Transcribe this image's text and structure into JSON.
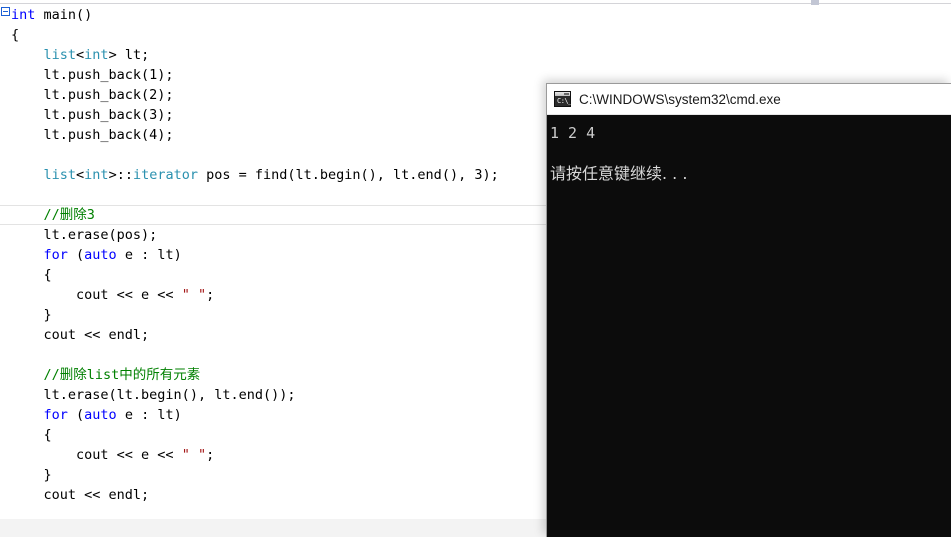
{
  "editor": {
    "name": "code-editor",
    "language": "cpp",
    "fold_marker": "collapse-minus",
    "lines": [
      {
        "indent": 0,
        "current": false,
        "tokens": [
          {
            "t": "kw",
            "v": "int"
          },
          {
            "t": "pln",
            "v": " main()"
          }
        ]
      },
      {
        "indent": 0,
        "current": false,
        "tokens": [
          {
            "t": "pln",
            "v": "{"
          }
        ]
      },
      {
        "indent": 1,
        "current": false,
        "tokens": [
          {
            "t": "type",
            "v": "list"
          },
          {
            "t": "pln",
            "v": "<"
          },
          {
            "t": "type",
            "v": "int"
          },
          {
            "t": "pln",
            "v": "> lt;"
          }
        ]
      },
      {
        "indent": 1,
        "current": false,
        "tokens": [
          {
            "t": "pln",
            "v": "lt.push_back(1);"
          }
        ]
      },
      {
        "indent": 1,
        "current": false,
        "tokens": [
          {
            "t": "pln",
            "v": "lt.push_back(2);"
          }
        ]
      },
      {
        "indent": 1,
        "current": false,
        "tokens": [
          {
            "t": "pln",
            "v": "lt.push_back(3);"
          }
        ]
      },
      {
        "indent": 1,
        "current": false,
        "tokens": [
          {
            "t": "pln",
            "v": "lt.push_back(4);"
          }
        ]
      },
      {
        "indent": 0,
        "current": false,
        "tokens": []
      },
      {
        "indent": 1,
        "current": false,
        "tokens": [
          {
            "t": "type",
            "v": "list"
          },
          {
            "t": "pln",
            "v": "<"
          },
          {
            "t": "type",
            "v": "int"
          },
          {
            "t": "pln",
            "v": ">::"
          },
          {
            "t": "type",
            "v": "iterator"
          },
          {
            "t": "pln",
            "v": " pos = find(lt.begin(), lt.end(), 3);"
          }
        ]
      },
      {
        "indent": 0,
        "current": false,
        "tokens": []
      },
      {
        "indent": 1,
        "current": true,
        "tokens": [
          {
            "t": "com",
            "v": "//删除3"
          }
        ]
      },
      {
        "indent": 1,
        "current": false,
        "tokens": [
          {
            "t": "pln",
            "v": "lt.erase(pos);"
          }
        ]
      },
      {
        "indent": 1,
        "current": false,
        "tokens": [
          {
            "t": "kw",
            "v": "for"
          },
          {
            "t": "pln",
            "v": " ("
          },
          {
            "t": "kw",
            "v": "auto"
          },
          {
            "t": "pln",
            "v": " e : lt)"
          }
        ]
      },
      {
        "indent": 1,
        "current": false,
        "tokens": [
          {
            "t": "pln",
            "v": "{"
          }
        ]
      },
      {
        "indent": 2,
        "current": false,
        "tokens": [
          {
            "t": "pln",
            "v": "cout << e << "
          },
          {
            "t": "str",
            "v": "\" \""
          },
          {
            "t": "pln",
            "v": ";"
          }
        ]
      },
      {
        "indent": 1,
        "current": false,
        "tokens": [
          {
            "t": "pln",
            "v": "}"
          }
        ]
      },
      {
        "indent": 1,
        "current": false,
        "tokens": [
          {
            "t": "pln",
            "v": "cout << endl;"
          }
        ]
      },
      {
        "indent": 0,
        "current": false,
        "tokens": []
      },
      {
        "indent": 1,
        "current": false,
        "tokens": [
          {
            "t": "com",
            "v": "//删除list中的所有元素"
          }
        ]
      },
      {
        "indent": 1,
        "current": false,
        "tokens": [
          {
            "t": "pln",
            "v": "lt.erase(lt.begin(), lt.end());"
          }
        ]
      },
      {
        "indent": 1,
        "current": false,
        "tokens": [
          {
            "t": "kw",
            "v": "for"
          },
          {
            "t": "pln",
            "v": " ("
          },
          {
            "t": "kw",
            "v": "auto"
          },
          {
            "t": "pln",
            "v": " e : lt)"
          }
        ]
      },
      {
        "indent": 1,
        "current": false,
        "tokens": [
          {
            "t": "pln",
            "v": "{"
          }
        ]
      },
      {
        "indent": 2,
        "current": false,
        "tokens": [
          {
            "t": "pln",
            "v": "cout << e << "
          },
          {
            "t": "str",
            "v": "\" \""
          },
          {
            "t": "pln",
            "v": ";"
          }
        ]
      },
      {
        "indent": 1,
        "current": false,
        "tokens": [
          {
            "t": "pln",
            "v": "}"
          }
        ]
      },
      {
        "indent": 1,
        "current": false,
        "tokens": [
          {
            "t": "pln",
            "v": "cout << endl;"
          }
        ]
      }
    ],
    "colors": {
      "keyword": "#0000ff",
      "type": "#2b91af",
      "string": "#a31515",
      "comment": "#008000",
      "plain": "#000000",
      "background": "#ffffff",
      "current_line_border": "#e3e3e3"
    }
  },
  "console": {
    "title": "C:\\WINDOWS\\system32\\cmd.exe",
    "icon": "cmd-icon",
    "icon_prompt": "C:\\_",
    "lines": [
      "1 2 4",
      "",
      "请按任意键继续. . ."
    ],
    "colors": {
      "background": "#0c0c0c",
      "text": "#cccccc",
      "titlebar": "#ffffff"
    }
  }
}
